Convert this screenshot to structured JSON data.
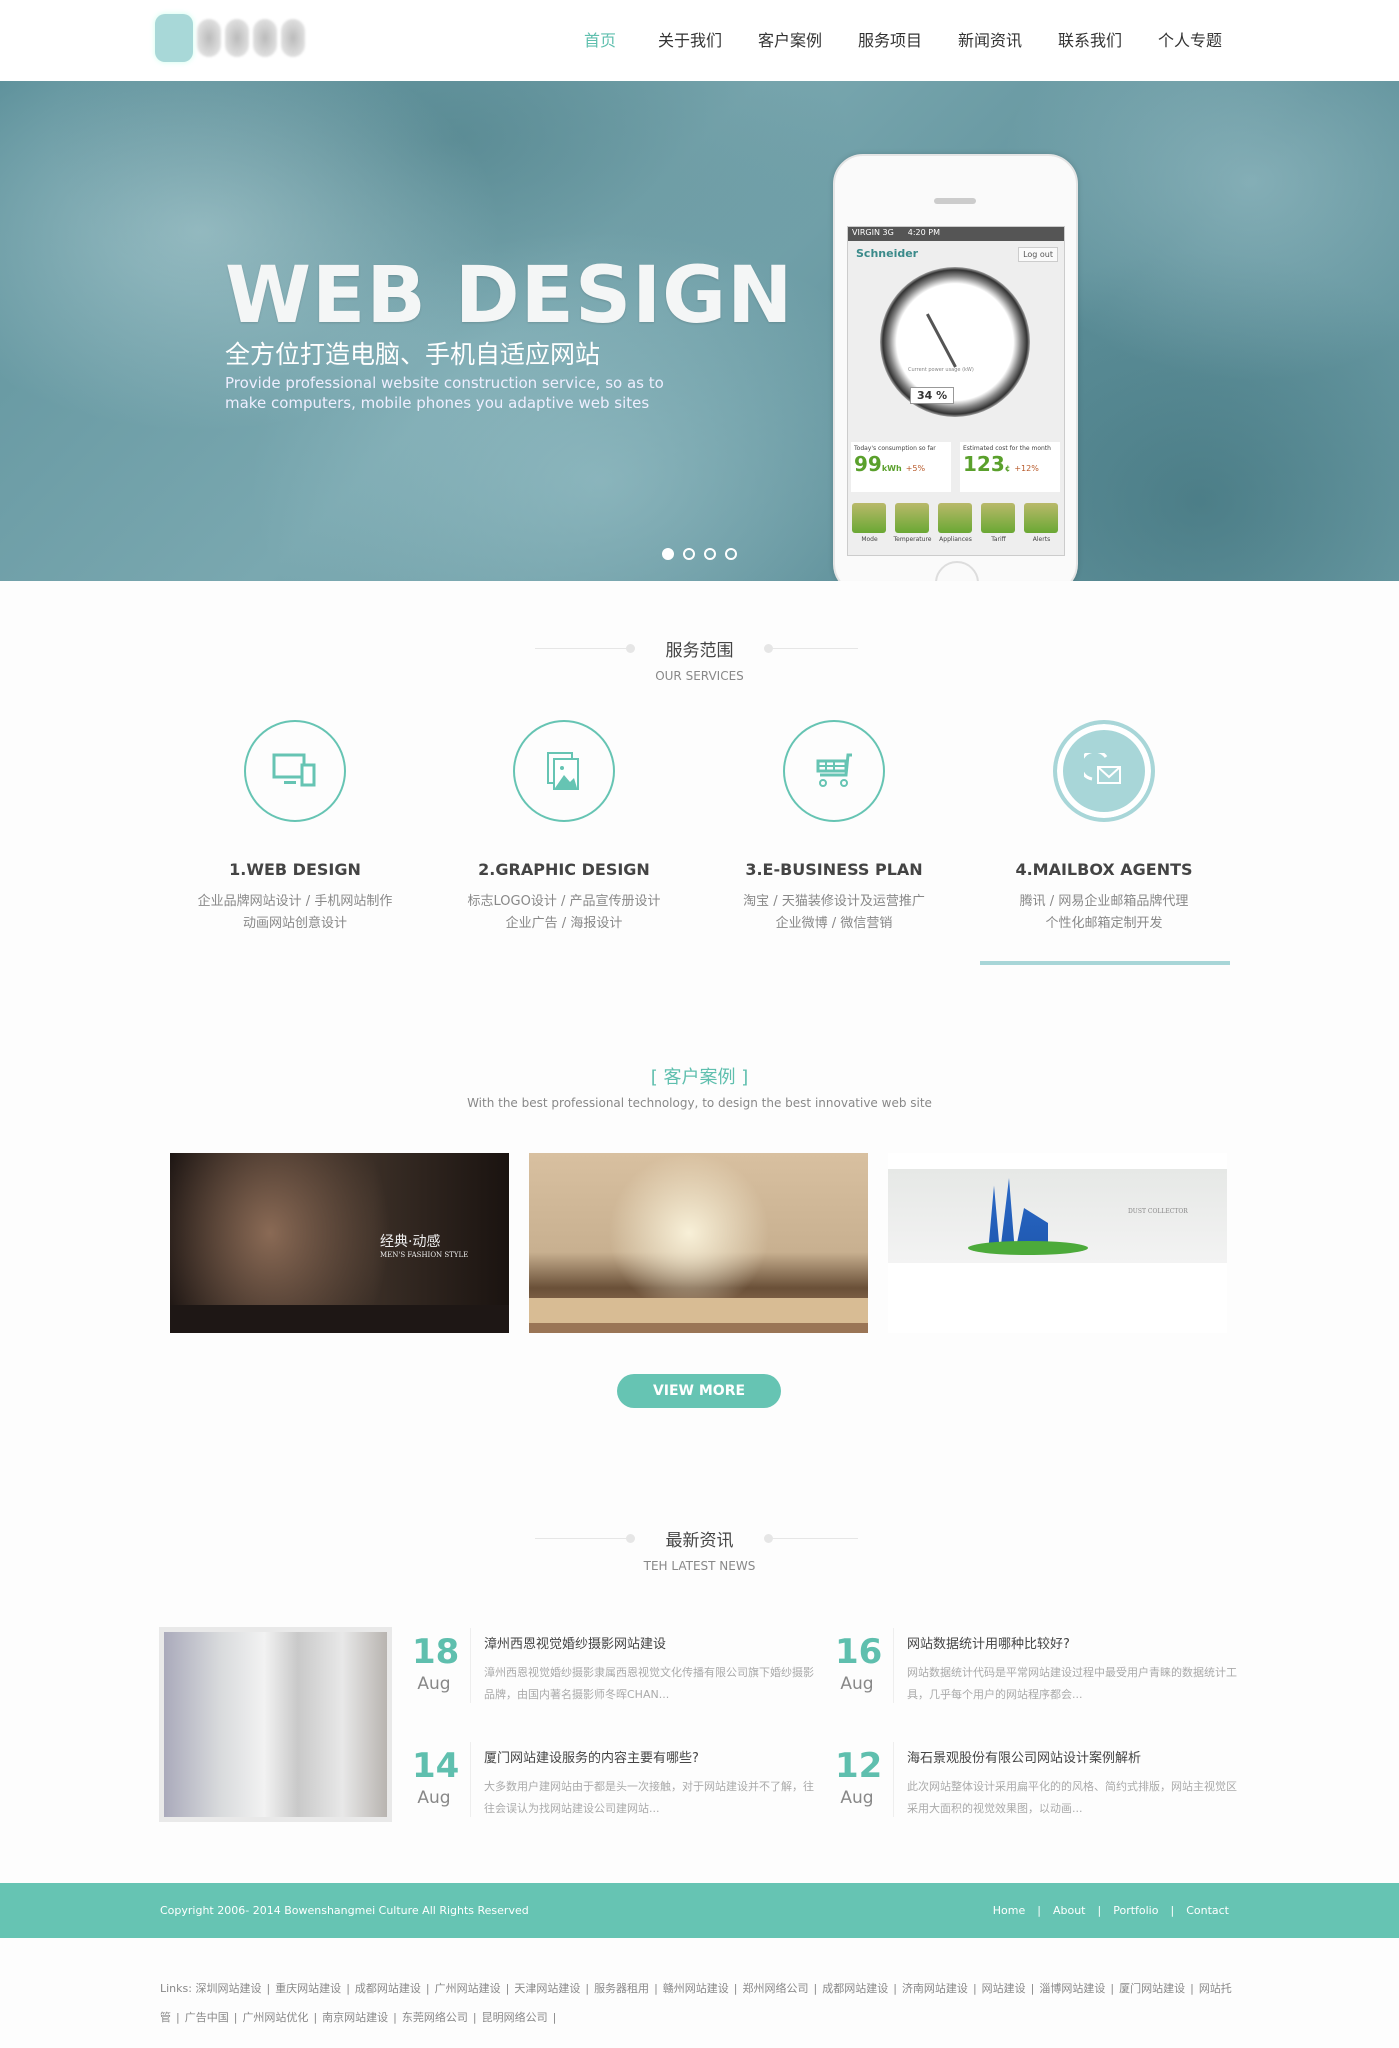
{
  "header": {
    "nav": [
      {
        "label": "首页",
        "active": true
      },
      {
        "label": "关于我们"
      },
      {
        "label": "客户案例"
      },
      {
        "label": "服务项目"
      },
      {
        "label": "新闻资讯"
      },
      {
        "label": "联系我们"
      },
      {
        "label": "个人专题"
      }
    ]
  },
  "hero": {
    "title": "WEB DESIGN",
    "subtitle": "全方位打造电脑、手机自适应网站",
    "desc": "Provide professional website construction service, so as to make computers, mobile phones you adaptive web sites",
    "slides": 4,
    "active_slide": 0,
    "phone": {
      "carrier": "VIRGIN  3G",
      "time": "4:20 PM",
      "brand": "Schneider",
      "logout": "Log out",
      "gauge_label": "Current power usage (kW)",
      "percent": "34 %",
      "stat1_label": "Today's consumption so far",
      "stat1_value": "99",
      "stat1_unit": "kWh",
      "stat1_change": "+5%",
      "stat2_label": "Estimated cost for the month",
      "stat2_value": "123",
      "stat2_unit": "¢",
      "stat2_change": "+12%",
      "buttons": [
        "Mode",
        "Temperature",
        "Appliances",
        "Tariff",
        "Alerts"
      ]
    }
  },
  "services": {
    "title": "服务范围",
    "subtitle": "OUR SERVICES",
    "items": [
      {
        "title": "1.WEB DESIGN",
        "line1": "企业品牌网站设计 / 手机网站制作",
        "line2": "动画网站创意设计",
        "icon": "monitor-icon"
      },
      {
        "title": "2.GRAPHIC DESIGN",
        "line1": "标志LOGO设计 / 产品宣传册设计",
        "line2": "企业广告 / 海报设计",
        "icon": "image-icon"
      },
      {
        "title": "3.E-BUSINESS PLAN",
        "line1": "淘宝 / 天猫装修设计及运营推广",
        "line2": "企业微博 / 微信营销",
        "icon": "cart-icon"
      },
      {
        "title": "4.MAILBOX AGENTS",
        "line1": "腾讯 / 网易企业邮箱品牌代理",
        "line2": "个性化邮箱定制开发",
        "icon": "mail-icon",
        "active": true
      }
    ]
  },
  "cases": {
    "title": "[ 客户案例 ]",
    "subtitle": "With the best professional technology, to design the best innovative web site",
    "items": [
      {
        "caption": "经典·动感",
        "caption2": "MEN'S FASHION STYLE"
      },
      {
        "caption": ""
      },
      {
        "caption": "DUST COLLECTOR"
      }
    ],
    "view_more": "VIEW MORE"
  },
  "news": {
    "title": "最新资讯",
    "subtitle": "TEH LATEST NEWS",
    "items": [
      {
        "day": "18",
        "month": "Aug",
        "title": "漳州西恩视觉婚纱摄影网站建设",
        "excerpt": "漳州西恩视觉婚纱摄影隶属西恩视觉文化传播有限公司旗下婚纱摄影品牌，由国内著名摄影师冬晖CHAN..."
      },
      {
        "day": "16",
        "month": "Aug",
        "title": "网站数据统计用哪种比较好?",
        "excerpt": "网站数据统计代码是平常网站建设过程中最受用户青睐的数据统计工具，几乎每个用户的网站程序都会..."
      },
      {
        "day": "14",
        "month": "Aug",
        "title": "厦门网站建设服务的内容主要有哪些?",
        "excerpt": "大多数用户建网站由于都是头一次接触，对于网站建设并不了解，往往会误认为找网站建设公司建网站..."
      },
      {
        "day": "12",
        "month": "Aug",
        "title": "海石景观股份有限公司网站设计案例解析",
        "excerpt": "此次网站整体设计采用扁平化的的风格、简约式排版，网站主视觉区采用大面积的视觉效果图，以动画..."
      }
    ]
  },
  "footer": {
    "copyright": "Copyright 2006- 2014 Bowenshangmei Culture All Rights Reserved",
    "nav": [
      "Home",
      "About",
      "Portfolio",
      "Contact"
    ]
  },
  "links": {
    "label": "Links:",
    "items": [
      "深圳网站建设",
      "重庆网站建设",
      "成都网站建设",
      "广州网站建设",
      "天津网站建设",
      "服务器租用",
      "赣州网站建设",
      "郑州网络公司",
      "成都网站建设",
      "济南网站建设",
      "网站建设",
      "淄博网站建设",
      "厦门网站建设",
      "网站托管",
      "广告中国",
      "广州网站优化",
      "南京网站建设",
      "东莞网络公司",
      "昆明网络公司"
    ]
  },
  "colors": {
    "accent": "#66c4b3",
    "accent_light": "#a8d6d8",
    "text": "#444444",
    "muted": "#888888"
  }
}
